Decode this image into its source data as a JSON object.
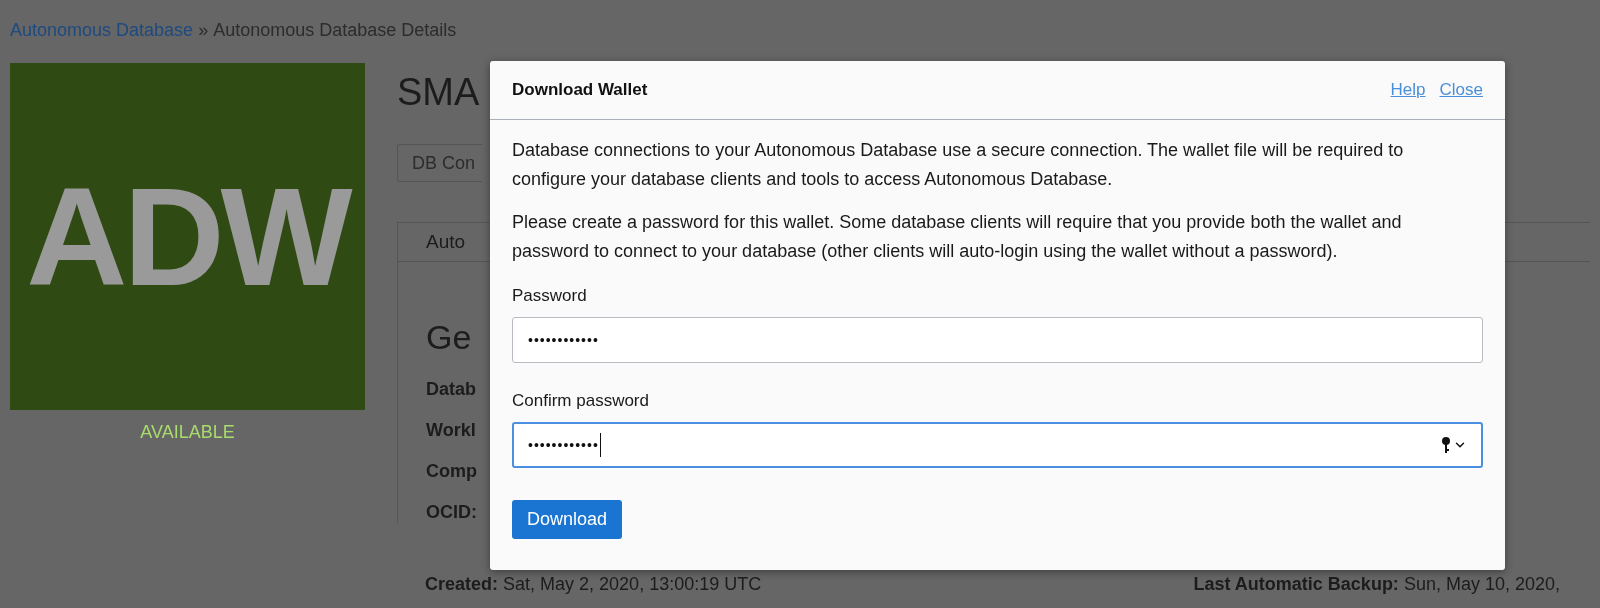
{
  "breadcrumb": {
    "link": "Autonomous Database",
    "separator": "»",
    "current": "Autonomous Database Details"
  },
  "tile": {
    "text": "ADW",
    "status": "AVAILABLE"
  },
  "background": {
    "title": "SMA",
    "button": "DB Con",
    "tab": "Auto",
    "section": "Ge",
    "fields": [
      "Datab",
      "Workl",
      "Comp",
      "OCID:"
    ],
    "created": {
      "label": "Created:",
      "value": "Sat, May 2, 2020, 13:00:19 UTC"
    },
    "last_backup": {
      "label": "Last Automatic Backup:",
      "value": "Sun, May 10, 2020,"
    }
  },
  "dialog": {
    "title": "Download Wallet",
    "links": [
      "Help",
      "Close"
    ],
    "paragraphs": [
      "Database connections to your Autonomous Database use a secure connection. The wallet file will be required to configure your database clients and tools to access Autonomous Database.",
      "Please create a password for this wallet. Some database clients will require that you provide both the wallet and password to connect to your database (other clients will auto-login using the wallet without a password)."
    ],
    "fields": [
      {
        "label": "Password",
        "value": "••••••••••••",
        "focused": false
      },
      {
        "label": "Confirm password",
        "value": "••••••••••••",
        "focused": true
      }
    ],
    "button": "Download"
  }
}
